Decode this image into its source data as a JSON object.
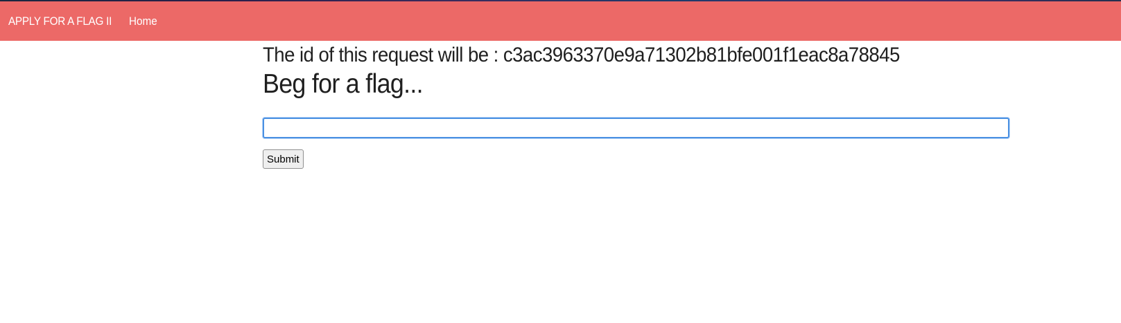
{
  "navbar": {
    "brand": "APPLY FOR A FLAG II",
    "links": [
      {
        "label": "Home"
      }
    ],
    "background_color": "#ec6967"
  },
  "main": {
    "request_id_text": "The id of this request will be : c3ac3963370e9a71302b81bfe001f1eac8a78845",
    "heading": "Beg for a flag...",
    "flag_input": {
      "value": "",
      "placeholder": ""
    },
    "submit_label": "Submit"
  }
}
